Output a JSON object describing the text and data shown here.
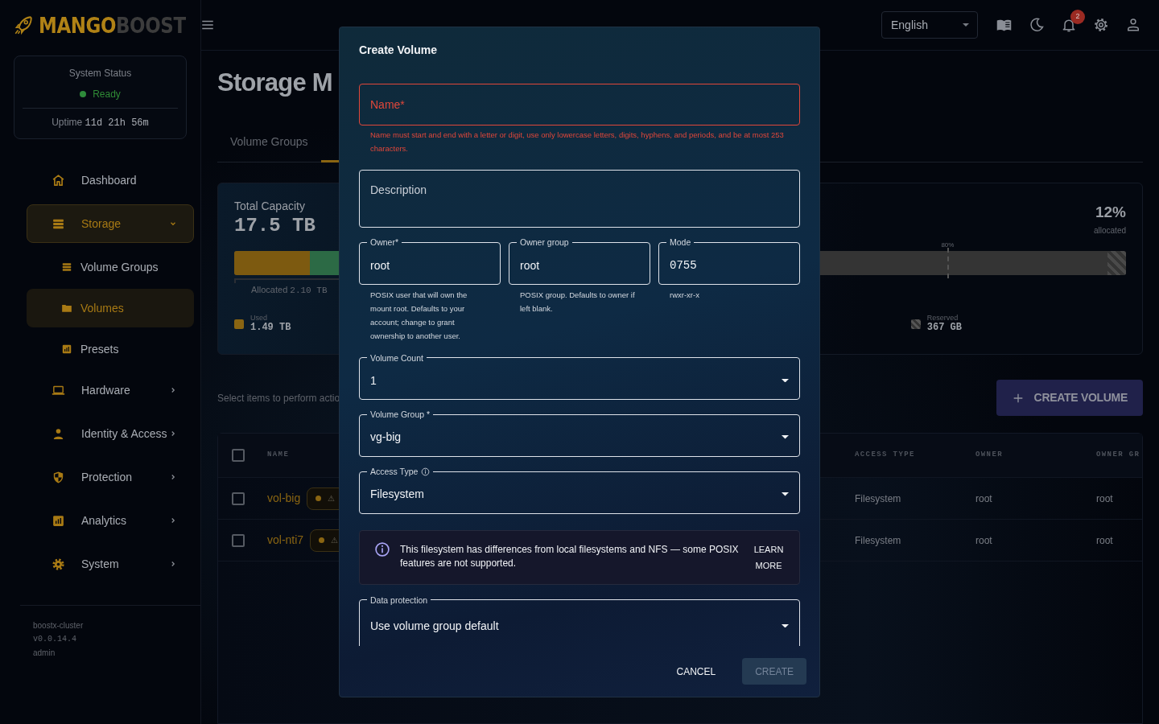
{
  "sidebar": {
    "logo": {
      "primary": "MANGO",
      "secondary": "BOOST"
    },
    "status": {
      "title": "System Status",
      "state": "Ready",
      "healthy": true,
      "uptime_label": "Uptime",
      "uptime": "11d 21h 56m"
    },
    "nav": [
      {
        "kind": "link",
        "label": "Dashboard",
        "selected": false
      },
      {
        "kind": "group",
        "label": "Storage",
        "selected": true,
        "expanded": true,
        "children": [
          {
            "label": "Volume Groups",
            "selected": false
          },
          {
            "label": "Volumes",
            "selected": true
          },
          {
            "label": "Presets",
            "selected": false
          }
        ]
      },
      {
        "kind": "group",
        "label": "Hardware",
        "selected": false,
        "expanded": false
      },
      {
        "kind": "group",
        "label": "Identity & Access",
        "selected": false,
        "expanded": false
      },
      {
        "kind": "group",
        "label": "Protection",
        "selected": false,
        "expanded": false
      },
      {
        "kind": "group",
        "label": "Analytics",
        "selected": false,
        "expanded": false
      },
      {
        "kind": "group",
        "label": "System",
        "selected": false,
        "expanded": false
      }
    ],
    "footer": {
      "cluster": "boostx-cluster",
      "version": "v0.0.14.4",
      "user": "admin"
    }
  },
  "topbar": {
    "language": "English",
    "notifications": "2"
  },
  "page": {
    "title": "Storage M",
    "tabs": [
      {
        "label": "Volume Groups",
        "selected": false
      },
      {
        "selected": true
      }
    ],
    "capacity": {
      "title": "Total Capacity",
      "total": "17.5 TB",
      "percent": "12%",
      "percent_caption": "allocated",
      "segments": [
        {
          "kind": "used",
          "level": 0.085
        },
        {
          "kind": "allocated",
          "level": 0.035
        },
        {
          "kind": "reserved",
          "level": 0.021
        }
      ],
      "threshold": {
        "label": "80%",
        "level": 0.8
      },
      "allocated_label": "Allocated",
      "allocated_value": "2.10 TB",
      "legend": [
        {
          "kind": "used",
          "label": "Used",
          "value": "1.49 TB"
        },
        {
          "kind": "reserved",
          "label": "Reserved",
          "value": "367 GB"
        }
      ]
    },
    "hint": "Select items to perform actio",
    "create_button": "CREATE VOLUME"
  },
  "table": {
    "all_selected": false,
    "columns": [
      "NAME",
      "ACCESS TYPE",
      "OWNER",
      "OWNER GR"
    ],
    "rows": [
      {
        "selected": false,
        "name": "vol-big",
        "badge": "⚠",
        "access_type": "Filesystem",
        "owner": "root",
        "owner_group": "root"
      },
      {
        "selected": false,
        "name": "vol-nti7",
        "badge": "⚠",
        "access_type": "Filesystem",
        "owner": "root",
        "owner_group": "root"
      }
    ]
  },
  "modal": {
    "title": "Create Volume",
    "name_field": {
      "placeholder": "Name*",
      "invalid": true,
      "error": "Name must start and end with a letter or digit, use only lowercase letters, digits, hyphens, and periods, and be at most 253 characters."
    },
    "description_field": {
      "placeholder": "Description"
    },
    "ownership": [
      {
        "kind": "text",
        "label": "Owner*",
        "value": "root",
        "helper": "POSIX user that will own the mount root. Defaults to your account; change to grant ownership to another user."
      },
      {
        "kind": "text",
        "label": "Owner group",
        "value": "root",
        "helper": "POSIX group. Defaults to owner if left blank."
      },
      {
        "kind": "mono",
        "label": "Mode",
        "value": "0755",
        "helper": "rwxr-xr-x"
      }
    ],
    "selects": [
      {
        "label": "Volume Count",
        "value": "1",
        "info": false
      },
      {
        "label": "Volume Group *",
        "value": "vg-big",
        "info": false
      },
      {
        "label": "Access Type",
        "value": "Filesystem",
        "info": true
      }
    ],
    "alert": {
      "text": "This filesystem has differences from local filesystems and NFS — some POSIX features are not supported.",
      "action": "LEARN MORE"
    },
    "data_protection": {
      "label": "Data protection",
      "value": "Use volume group default"
    },
    "buttons": [
      {
        "kind": "text",
        "label": "CANCEL",
        "disabled": false
      },
      {
        "kind": "contained",
        "label": "CREATE",
        "disabled": true
      }
    ]
  }
}
